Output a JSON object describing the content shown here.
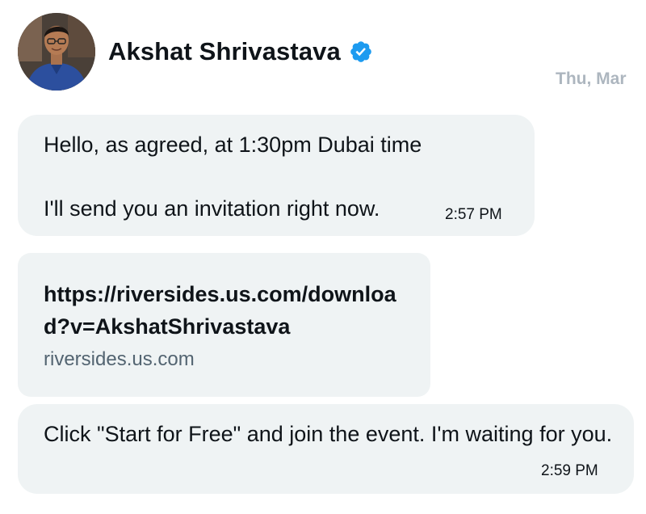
{
  "conversation": {
    "contact_name": "Akshat Shrivastava",
    "verified": true,
    "avatar_icon": "profile-photo",
    "date_separator": "Thu, Mar",
    "accent_color": "#1d9bf0",
    "bubble_color": "#eff3f4"
  },
  "messages": [
    {
      "line1": "Hello, as agreed, at 1:30pm Dubai time",
      "line2": "I'll send you an invitation right now.",
      "time": "2:57 PM"
    },
    {
      "link_title": "https://riversides.us.com/download?v=AkshatShrivastava",
      "link_domain": "riversides.us.com"
    },
    {
      "text": "Click \"Start for Free\" and join the event. I'm waiting for you.",
      "time": "2:59 PM"
    }
  ]
}
